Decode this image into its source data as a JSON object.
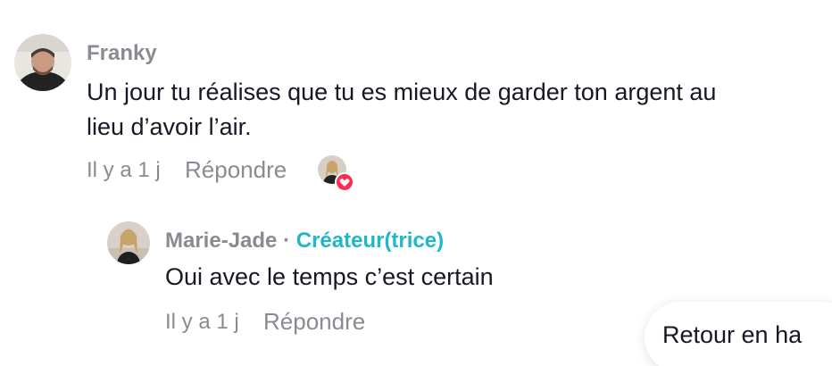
{
  "comment": {
    "author": "Franky",
    "text_line1": "Un jour tu réalises que tu es mieux de garder ton argent au",
    "text_line2": "lieu d’avoir l’air.",
    "time": "Il y a 1 j",
    "reply_label": "Répondre",
    "liked_by_creator_icon": "heart-icon"
  },
  "reply": {
    "author": "Marie-Jade",
    "separator": "·",
    "badge": "Créateur(trice)",
    "text": "Oui avec le temps c’est certain",
    "time": "Il y a 1 j",
    "reply_label": "Répondre"
  },
  "back_to_top": {
    "label": "Retour en ha"
  },
  "colors": {
    "secondary_text": "#8a8b91",
    "creator_accent": "#20b8c6",
    "like_heart": "#fe2c55",
    "primary_text": "#161823"
  }
}
